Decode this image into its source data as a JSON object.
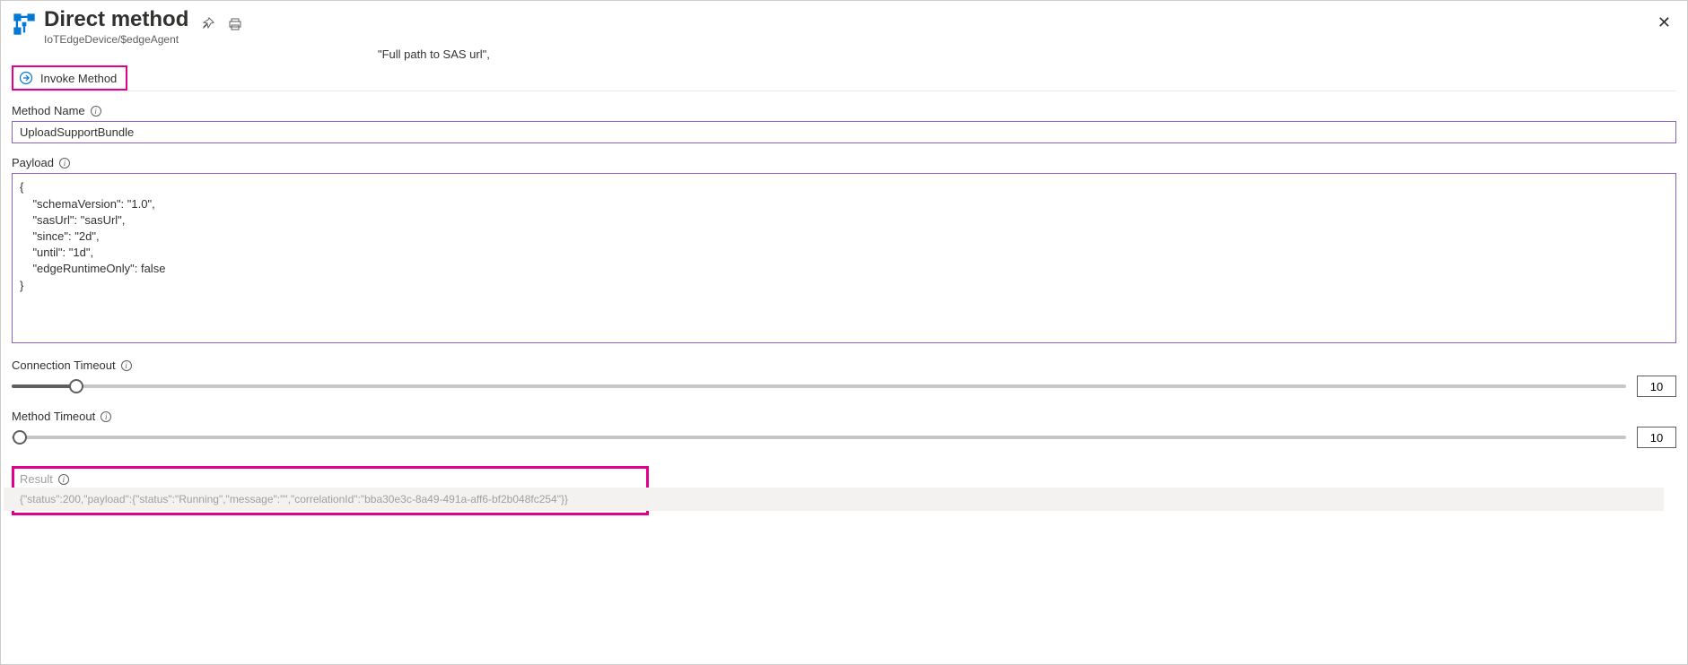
{
  "header": {
    "title": "Direct method",
    "subtitle": "IoTEdgeDevice/$edgeAgent"
  },
  "floating": "\"Full path to SAS url\",",
  "toolbar": {
    "invoke_label": "Invoke Method"
  },
  "methodName": {
    "label": "Method Name",
    "value": "UploadSupportBundle"
  },
  "payload": {
    "label": "Payload",
    "value": "{\n    \"schemaVersion\": \"1.0\",\n    \"sasUrl\": \"sasUrl\",\n    \"since\": \"2d\",\n    \"until\": \"1d\",\n    \"edgeRuntimeOnly\": false\n}"
  },
  "connectionTimeout": {
    "label": "Connection Timeout",
    "value": "10"
  },
  "methodTimeout": {
    "label": "Method Timeout",
    "value": "10"
  },
  "result": {
    "label": "Result",
    "value": "{\"status\":200,\"payload\":{\"status\":\"Running\",\"message\":\"\",\"correlationId\":\"bba30e3c-8a49-491a-aff6-bf2b048fc254\"}}"
  }
}
